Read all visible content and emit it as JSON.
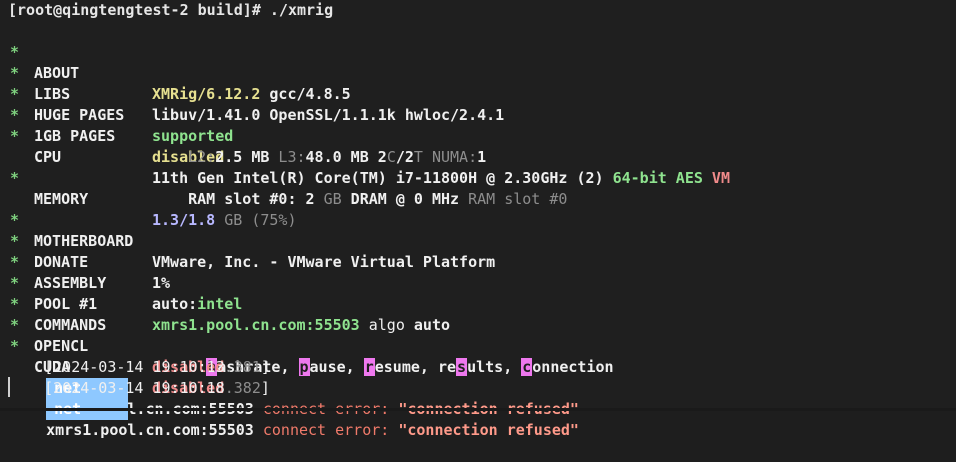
{
  "prompt": "[root@qingtengtest-2 build]# ./xmrig",
  "rows": [
    {
      "key": "ABOUT",
      "v1": "XMRig/6.12.2",
      "v2": " gcc/4.8.5"
    },
    {
      "key": "LIBS",
      "v1": "libuv/1.41.0 OpenSSL/1.1.1k hwloc/2.4.1"
    },
    {
      "key": "HUGE PAGES",
      "v1": "supported"
    },
    {
      "key": "1GB PAGES",
      "v1": "disabled"
    },
    {
      "key": "CPU",
      "v1": "11th Gen Intel(R) Core(TM) i7-11800H @ 2.30GHz (2) ",
      "v2": "64-bit AES",
      "v3": " VM"
    },
    {
      "key": "MEMORY",
      "v1": "1.3/1.8",
      "v2": " GB",
      "v3": " (75%)"
    },
    {
      "key": "MOTHERBOARD",
      "v1": "VMware, Inc. - VMware Virtual Platform"
    },
    {
      "key": "DONATE",
      "v1": "1%"
    },
    {
      "key": "ASSEMBLY",
      "v1": "auto:",
      "v2": "intel"
    },
    {
      "key": "POOL #1",
      "v1": "xmrs1.pool.cn.com:55503",
      "v2": " algo ",
      "v3": "auto"
    },
    {
      "key": "COMMANDS"
    },
    {
      "key": "OPENCL",
      "v1": "disabled"
    },
    {
      "key": "CUDA",
      "v1": "disabled"
    }
  ],
  "cpu_cache": {
    "l2_label": "L2:",
    "l2": "2.5 MB",
    "l3_label": " L3:",
    "l3": "48.0 MB",
    "cores": " 2",
    "c": "C",
    "slash": "/",
    "threads": "2",
    "t": "T",
    "numa_label": " NUMA:",
    "numa": "1"
  },
  "ram_slot": {
    "label": "RAM slot #0: ",
    "size": "2",
    "unit": " GB",
    "desc": " DRAM @ 0 MHz",
    "slot_name": " RAM slot #0"
  },
  "commands": [
    {
      "key": "h",
      "rest": "ashrate",
      "sep": ", "
    },
    {
      "key": "p",
      "rest": "ause",
      "sep": ", "
    },
    {
      "key": "r",
      "rest": "esume",
      "sep": ", "
    },
    {
      "key_prefix": "re",
      "key": "s",
      "rest": "ults",
      "sep": ", "
    },
    {
      "key": "c",
      "rest": "onnection",
      "sep": ""
    }
  ],
  "logs": [
    {
      "ts_open": "[",
      "ts": "2024-03-14 19:10:13",
      "ms": ".381",
      "ts_close": "]",
      "tag": "net",
      "host": "xmrs1.pool.cn.com:55503",
      "err": " connect error: ",
      "msg": "\"connection refused\""
    },
    {
      "ts_open": "[",
      "ts": "2024-03-14 19:10:18",
      "ms": ".382",
      "ts_close": "]",
      "tag": "net",
      "host": "xmrs1.pool.cn.com:55503",
      "err": " connect error: ",
      "msg": "\"connection refused\""
    }
  ],
  "star": "*",
  "colors": {
    "green": "#8fe38f",
    "yellow": "#e6e090",
    "pink": "#f08a8a",
    "net_tag": "#8ec8ff",
    "background": "#1f1f1f"
  }
}
